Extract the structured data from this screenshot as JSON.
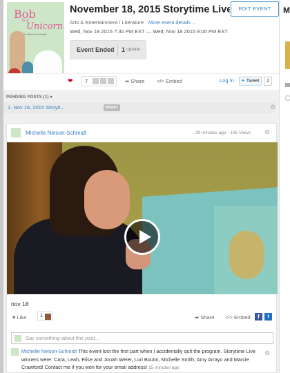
{
  "event": {
    "title": "November 18, 2015 Storytime Live! ...",
    "edit_label": "EDIT EVENT",
    "category": "Arts & Entertainment / Literature",
    "category_sep": " · ",
    "more_details": "More event details ...",
    "dates": "Wed, Nov 18 2015 7:30 PM EST — Wed, Nov 18 2015 8:00 PM EST",
    "status": "Event Ended",
    "update_count": "1",
    "update_label": "update",
    "cover": {
      "title_line1": "Bob",
      "title_is_a": "is a",
      "title_line2": "Unicorn",
      "author": "by Michelle Nelson-Schmidt"
    }
  },
  "actions": {
    "like_count": "7",
    "share": "Share",
    "embed": "Embed",
    "login": "Log In",
    "tweet": "Tweet",
    "tweet_count": "2"
  },
  "pending": {
    "header": "PENDING POSTS (1)",
    "item": "1. Nov 18, 2015 Storyti...",
    "draft": "DRAFT"
  },
  "post": {
    "author": "Michelle Nelson-Schmidt",
    "time": "20 minutes ago",
    "views": "106 Views",
    "caption": "nov 18",
    "like": "Like",
    "like_count": "1",
    "share": "Share",
    "embed": "Embed",
    "comment_placeholder": "Say something about this post...",
    "comment": {
      "author": "Michelle Nelson-Schmidt",
      "text": " This event lost the first part when I accidentally quit the program. Storytime Live winners were: Cara, Leah, Elise and Jonah Weier, Lori Boutin, Michelle Smith, Amy Arrayo and Marcie Crawford! Contact me if you won for your email address!",
      "time": "15 minutes ago"
    }
  },
  "right_strip": {
    "initial": "M"
  },
  "icons": {
    "heart": "heart-icon",
    "share": "share-icon",
    "embed": "embed-icon",
    "gear": "gear-icon",
    "play": "play-icon",
    "facebook": "facebook-icon",
    "twitter": "twitter-icon"
  },
  "colors": {
    "link": "#3a7fc0",
    "heart": "#d0021b",
    "facebook": "#3b5998",
    "twitter": "#1da1f2"
  }
}
